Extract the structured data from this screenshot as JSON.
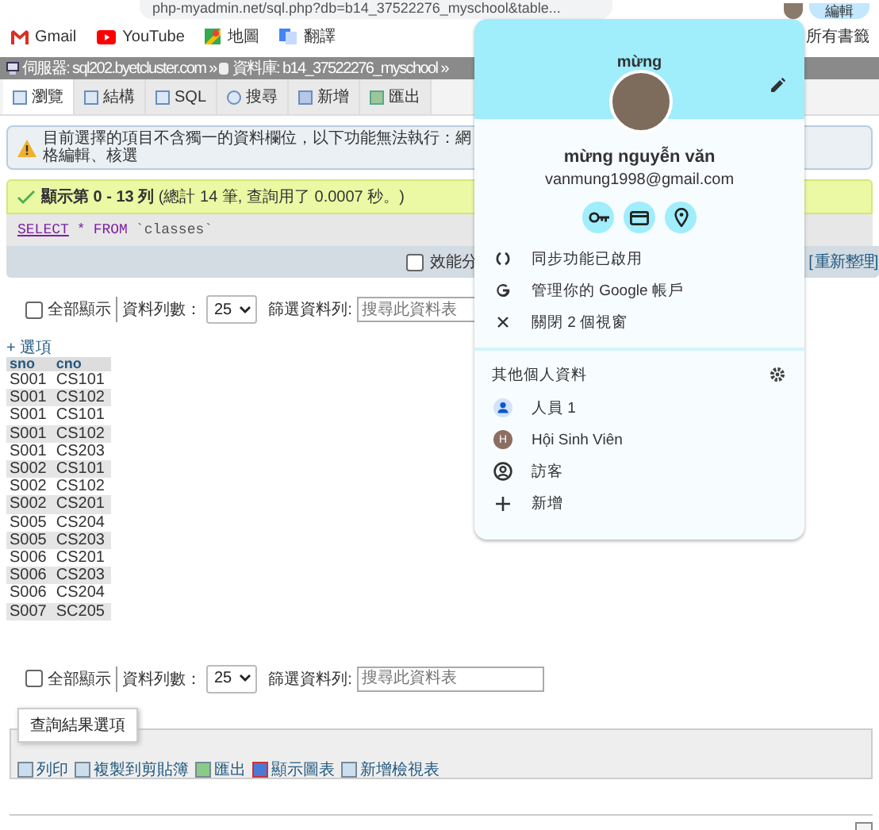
{
  "browser": {
    "address": "php-myadmin.net/sql.php?db=b14_37522276_myschool&table...",
    "profile_button": "編輯"
  },
  "bookmarks": [
    {
      "label": "Gmail",
      "kind": "gmail"
    },
    {
      "label": "YouTube",
      "kind": "youtube"
    },
    {
      "label": "地圖",
      "kind": "maps"
    },
    {
      "label": "翻譯",
      "kind": "translate"
    }
  ],
  "all_bookmarks": "所有書籤",
  "breadcrumb": [
    {
      "label": "伺服器: sql202.byetcluster.com »",
      "kind": "server"
    },
    {
      "label": "資料庫: b14_37522276_myschool »",
      "kind": "database"
    }
  ],
  "tabs": [
    {
      "label": "瀏覽",
      "kind": "browse",
      "selected": true
    },
    {
      "label": "結構",
      "kind": "structure",
      "selected": false
    },
    {
      "label": "SQL",
      "kind": "sql",
      "selected": false
    },
    {
      "label": "搜尋",
      "kind": "search",
      "selected": false
    },
    {
      "label": "新增",
      "kind": "insert",
      "selected": false
    },
    {
      "label": "匯出",
      "kind": "export",
      "selected": false
    }
  ],
  "warning": "目前選擇的項目不含獨一的資料欄位，以下功能無法執行：網格編輯、核選",
  "success": "**顯示第 0 - 13 列** (總計 14 筆, 查詢用了 0.0007 秒。)",
  "sql_query": [
    {
      "text": "SELECT",
      "kind": "link"
    },
    {
      "text": "*",
      "kind": "keyword"
    },
    {
      "text": "FROM",
      "kind": "keyword"
    },
    {
      "text": "`classes`",
      "kind": "ident"
    }
  ],
  "profiling": {
    "label": "效能分",
    "checked": false
  },
  "refresh": "[ 重新整理]",
  "controls_top": {
    "show_all": {
      "label": "全部顯示",
      "checked": false
    },
    "rows_label": "資料列數：",
    "rows_value": "25",
    "filter_label": "篩選資料列:",
    "filter_placeholder": "搜尋此資料表"
  },
  "options_link": "+ 選項",
  "table": {
    "columns": [
      "sno",
      "cno"
    ],
    "rows": [
      [
        "S001",
        "CS101"
      ],
      [
        "S001",
        "CS102"
      ],
      [
        "S001",
        "CS101"
      ],
      [
        "S001",
        "CS102"
      ],
      [
        "S001",
        "CS203"
      ],
      [
        "S002",
        "CS101"
      ],
      [
        "S002",
        "CS102"
      ],
      [
        "S002",
        "CS201"
      ],
      [
        "S005",
        "CS204"
      ],
      [
        "S005",
        "CS203"
      ],
      [
        "S006",
        "CS201"
      ],
      [
        "S006",
        "CS203"
      ],
      [
        "S006",
        "CS204"
      ],
      [
        "S007",
        "SC205"
      ]
    ]
  },
  "controls_bottom": {
    "show_all": {
      "label": "全部顯示",
      "checked": false
    },
    "rows_label": "資料列數：",
    "rows_value": "25",
    "filter_label": "篩選資料列:",
    "filter_placeholder": "搜尋此資料表"
  },
  "result_options": {
    "legend": "查詢結果選項",
    "actions": [
      {
        "label": "列印",
        "kind": "print"
      },
      {
        "label": "複製到剪貼簿",
        "kind": "copy"
      },
      {
        "label": "匯出",
        "kind": "export"
      },
      {
        "label": "顯示圖表",
        "kind": "chart"
      },
      {
        "label": "新增檢視表",
        "kind": "view"
      }
    ]
  },
  "popup": {
    "title": "mừng",
    "name": "mừng nguyễn văn",
    "email": "vanmung1998@gmail.com",
    "menu": [
      {
        "label": "同步功能已啟用",
        "kind": "sync"
      },
      {
        "label": "管理你的 Google 帳戶",
        "kind": "google"
      },
      {
        "label": "關閉 2 個視窗",
        "kind": "close"
      }
    ],
    "other_title": "其他個人資料",
    "profiles": [
      {
        "label": "人員 1",
        "kind": "person"
      },
      {
        "label": "Hội Sinh Viên",
        "kind": "letter",
        "initial": "H",
        "color": "#8d6e63"
      },
      {
        "label": "訪客",
        "kind": "guest"
      },
      {
        "label": "新增",
        "kind": "add"
      }
    ]
  }
}
